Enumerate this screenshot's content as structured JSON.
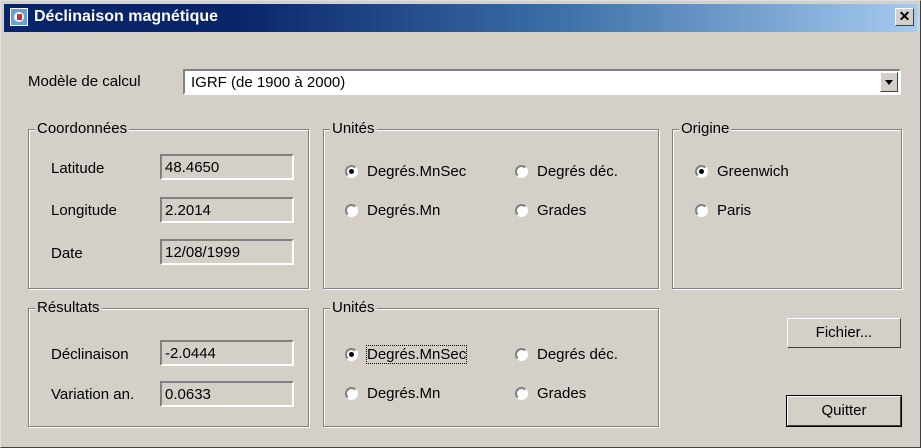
{
  "window": {
    "title": "Déclinaison magnétique",
    "close_glyph": "✕",
    "title_icon": "app-icon"
  },
  "model": {
    "label": "Modèle de calcul",
    "selected": "IGRF (de 1900 à 2000)"
  },
  "coords": {
    "title": "Coordonnées",
    "latitude_label": "Latitude",
    "latitude_value": "48.4650",
    "longitude_label": "Longitude",
    "longitude_value": "2.2014",
    "date_label": "Date",
    "date_value": "12/08/1999"
  },
  "units1": {
    "title": "Unités",
    "opt1": "Degrés.MnSec",
    "opt2": "Degrés déc.",
    "opt3": "Degrés.Mn",
    "opt4": "Grades",
    "selected": "Degrés.MnSec"
  },
  "origin": {
    "title": "Origine",
    "opt1": "Greenwich",
    "opt2": "Paris",
    "selected": "Greenwich"
  },
  "results": {
    "title": "Résultats",
    "declinaison_label": "Déclinaison",
    "declinaison_value": "-2.0444",
    "variation_label": "Variation an.",
    "variation_value": "0.0633"
  },
  "units2": {
    "title": "Unités",
    "opt1": "Degrés.MnSec",
    "opt2": "Degrés déc.",
    "opt3": "Degrés.Mn",
    "opt4": "Grades",
    "selected": "Degrés.MnSec"
  },
  "buttons": {
    "file": "Fichier...",
    "quit": "Quitter"
  }
}
